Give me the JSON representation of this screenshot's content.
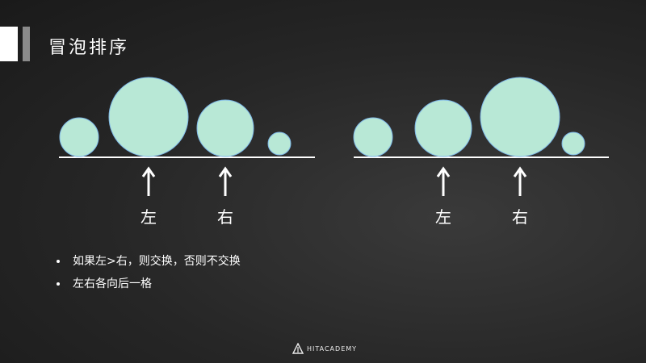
{
  "title": "冒泡排序",
  "labels": {
    "left": "左",
    "right": "右"
  },
  "bullets": [
    "如果左>右，则交换，否则不交换",
    "左右各向后一格"
  ],
  "logo_text": "HITACADEMY",
  "colors": {
    "bubble": "#b8e8d6",
    "bubble_stroke": "#7fb8e8",
    "line": "#ffffff"
  },
  "icons": [
    "arrow-up-icon",
    "triangle-logo-icon"
  ]
}
